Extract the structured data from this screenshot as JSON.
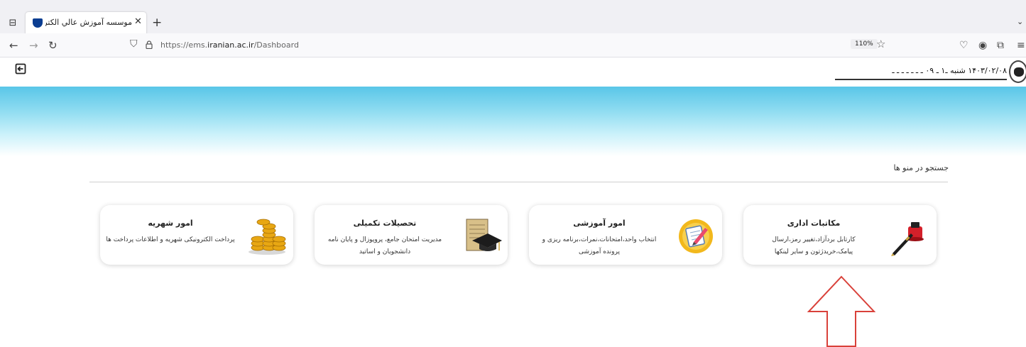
{
  "browser": {
    "tab_title": "موسسه آموزش عالي الكترونيكي",
    "url_prefix": "https://ems.",
    "url_domain": "iranian.ac.ir",
    "url_path": "/Dashboard",
    "zoom": "110%"
  },
  "header": {
    "user_info": "۱۴۰۳/۰۲/۰۸ شنبه ـ۱ ـ ۰۹ ـ ـ ـ ـ ـ ـ ـ"
  },
  "search": {
    "label": "جستجو در منو ها"
  },
  "cards": [
    {
      "title": "مکاتبات اداری",
      "desc1": "کارتابل بردآزاد،تغییر رمز،ارسال",
      "desc2": "پیامک،خریدژتون و سایر لینکها",
      "icon": "inkwell-pen-icon"
    },
    {
      "title": "امور آموزشی",
      "desc1": "انتخاب واحد،امتحانات،نمرات،برنامه ریزی و",
      "desc2": "پرونده آموزشی",
      "icon": "notepad-pencil-icon"
    },
    {
      "title": "تحصیلات تکمیلی",
      "desc1": "مدیریت امتحان جامع، پروپوزال و پایان نامه",
      "desc2": "دانشجویان و اساتید",
      "icon": "graduation-cap-icon"
    },
    {
      "title": "امور شهریه",
      "desc1": "پرداخت الکترونیکی شهریه و اطلاعات پرداخت ها",
      "desc2": "",
      "icon": "gold-coins-icon"
    }
  ],
  "colors": {
    "banner_top": "#59c6e8",
    "arrow": "#d9413a"
  }
}
